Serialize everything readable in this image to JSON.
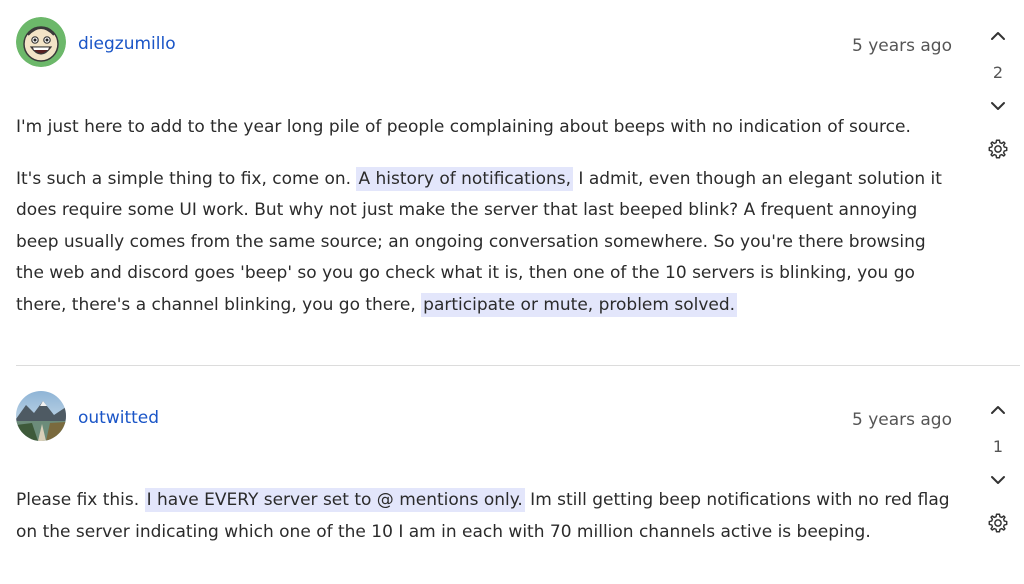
{
  "comments": [
    {
      "username": "diegzumillo",
      "avatar_icon": "smiling-cartoon-face-avatar",
      "timestamp": "5 years ago",
      "vote_count": "2",
      "paragraphs": [
        {
          "segments": [
            {
              "text": "I'm just here to add to the year long pile of people complaining about beeps with no indication of source.",
              "highlight": false
            }
          ]
        },
        {
          "segments": [
            {
              "text": "It's such a simple thing to fix, come on. ",
              "highlight": false
            },
            {
              "text": "A history of notifications,",
              "highlight": true
            },
            {
              "text": " I admit, even though an elegant solution it does require some UI work. But why not just make the server that last beeped blink? A frequent annoying beep usually comes from the same source; an ongoing conversation somewhere. So you're there browsing the web and discord goes 'beep' so you go check what it is, then one of the 10 servers is blinking, you go there, there's a channel blinking, you go there, ",
              "highlight": false
            },
            {
              "text": "participate or mute, problem solved.",
              "highlight": true
            }
          ]
        }
      ]
    },
    {
      "username": "outwitted",
      "avatar_icon": "mountain-lake-avatar",
      "timestamp": "5 years ago",
      "vote_count": "1",
      "paragraphs": [
        {
          "segments": [
            {
              "text": "Please fix this. ",
              "highlight": false
            },
            {
              "text": "I have EVERY server set to @ mentions only.",
              "highlight": true
            },
            {
              "text": " Im still getting beep notifications with no red flag on the server indicating which one of the 10 I am in each with 70 million channels active is beeping.",
              "highlight": false
            }
          ]
        }
      ]
    }
  ],
  "colors": {
    "link": "#1a55c7",
    "highlight": "#e3e6fb",
    "divider": "#dcdcdc",
    "text": "#2b2b2b"
  }
}
